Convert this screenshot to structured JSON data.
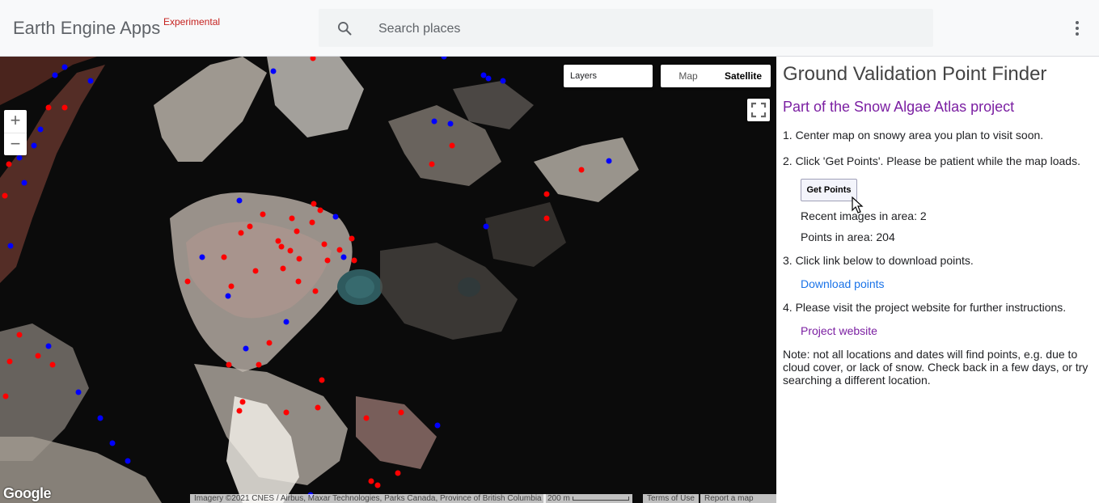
{
  "topbar": {
    "brand": "Earth Engine Apps",
    "brand_tag": "Experimental",
    "search_placeholder": "Search places"
  },
  "map": {
    "zoom_in": "+",
    "zoom_out": "−",
    "layers_label": "Layers",
    "map_type_map": "Map",
    "map_type_satellite": "Satellite",
    "selected_map_type": "Satellite",
    "google_logo": "Google",
    "attribution": "Imagery ©2021 CNES / Airbus, Maxar Technologies, Parks Canada, Province of British Columbia",
    "scale_label": "200 m",
    "terms": "Terms of Use",
    "report": "Report a map error",
    "point_colors": {
      "red": "#ff0000",
      "blue": "#0000ff"
    }
  },
  "panel": {
    "title": "Ground Validation Point Finder",
    "subtitle": "Part of the Snow Algae Atlas project",
    "step1": "1. Center map on snowy area you plan to visit soon.",
    "step2": "2. Click 'Get Points'. Please be patient while the map loads.",
    "get_points_button": "Get Points",
    "recent_images": "Recent images in area: 2",
    "points_in_area": "Points in area: 204",
    "step3": "3. Click link below to download points.",
    "download_link": "Download points",
    "step4": "4. Please visit the project website for further instructions.",
    "project_link": "Project website",
    "note": "Note: not all locations and dates will find points, e.g. due to cloud cover, or lack of snow. Check back in a few days, or try searching a different location."
  },
  "colors": {
    "subtitle": "#7b1fa2",
    "download_link": "#1a73e8",
    "project_link": "#7b1fa2",
    "experimental_tag": "#c5221f"
  }
}
